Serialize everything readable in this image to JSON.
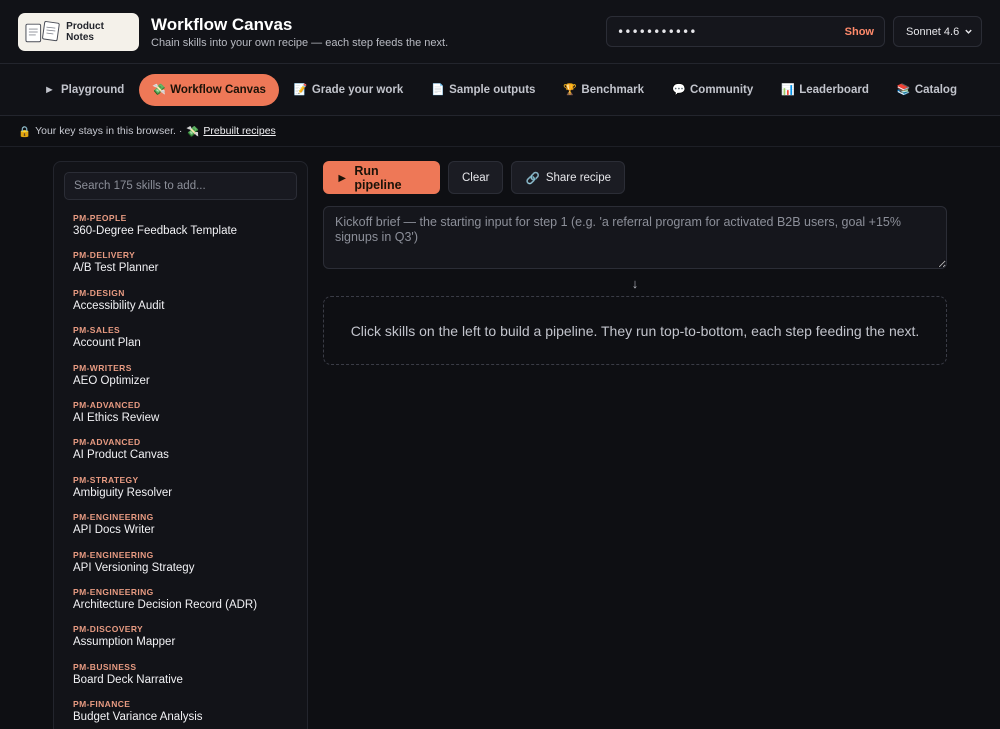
{
  "header": {
    "logo_text": "Product Notes",
    "title": "Workflow Canvas",
    "subtitle": "Chain skills into your own recipe — each step feeds the next.",
    "api_key_value": "•••••••••••",
    "show_label": "Show",
    "model": "Sonnet 4.6"
  },
  "nav": {
    "tabs": [
      {
        "icon": "►",
        "label": "Playground"
      },
      {
        "icon": "💸",
        "label": "Workflow Canvas",
        "active": true
      },
      {
        "icon": "📝",
        "label": "Grade your work"
      },
      {
        "icon": "📄",
        "label": "Sample outputs"
      },
      {
        "icon": "🏆",
        "label": "Benchmark"
      },
      {
        "icon": "💬",
        "label": "Community"
      },
      {
        "icon": "📊",
        "label": "Leaderboard"
      },
      {
        "icon": "📚",
        "label": "Catalog"
      }
    ]
  },
  "infobar": {
    "lock_icon": "🔒",
    "text": "Your key stays in this browser. ·",
    "recipes_icon": "💸",
    "recipes_link": "Prebuilt recipes"
  },
  "sidebar": {
    "search_placeholder": "Search 175 skills to add...",
    "skills": [
      {
        "category": "PM-PEOPLE",
        "name": "360-Degree Feedback Template"
      },
      {
        "category": "PM-DELIVERY",
        "name": "A/B Test Planner"
      },
      {
        "category": "PM-DESIGN",
        "name": "Accessibility Audit"
      },
      {
        "category": "PM-SALES",
        "name": "Account Plan"
      },
      {
        "category": "PM-WRITERS",
        "name": "AEO Optimizer"
      },
      {
        "category": "PM-ADVANCED",
        "name": "AI Ethics Review"
      },
      {
        "category": "PM-ADVANCED",
        "name": "AI Product Canvas"
      },
      {
        "category": "PM-STRATEGY",
        "name": "Ambiguity Resolver"
      },
      {
        "category": "PM-ENGINEERING",
        "name": "API Docs Writer"
      },
      {
        "category": "PM-ENGINEERING",
        "name": "API Versioning Strategy"
      },
      {
        "category": "PM-ENGINEERING",
        "name": "Architecture Decision Record (ADR)"
      },
      {
        "category": "PM-DISCOVERY",
        "name": "Assumption Mapper"
      },
      {
        "category": "PM-BUSINESS",
        "name": "Board Deck Narrative"
      },
      {
        "category": "PM-FINANCE",
        "name": "Budget Variance Analysis"
      }
    ]
  },
  "workarea": {
    "run_icon": "►",
    "run_label": "Run pipeline",
    "clear_label": "Clear",
    "share_icon": "🔗",
    "share_label": "Share recipe",
    "brief_placeholder": "Kickoff brief — the starting input for step 1 (e.g. 'a referral program for activated B2B users, goal +15% signups in Q3')",
    "arrow": "↓",
    "empty_message": "Click skills on the left to build a pipeline. They run top-to-bottom, each step feeding the next."
  },
  "colors": {
    "accent": "#ee7857",
    "background": "#0e0f13",
    "category_text": "#e89b82"
  }
}
